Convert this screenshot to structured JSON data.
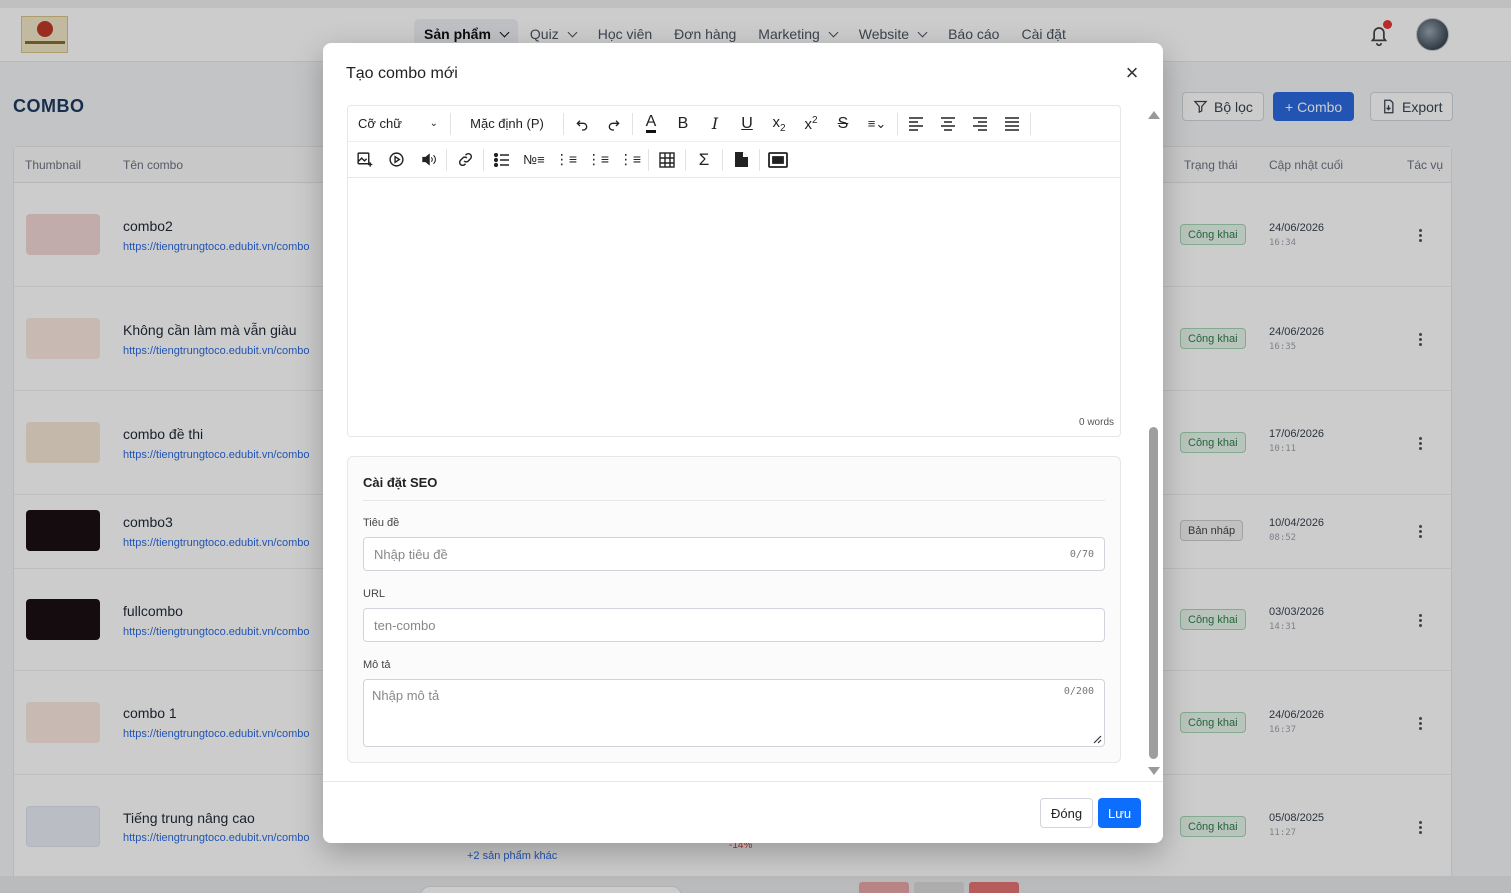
{
  "nav": {
    "items": [
      {
        "label": "Sản phẩm",
        "dropdown": true,
        "active": true
      },
      {
        "label": "Quiz",
        "dropdown": true
      },
      {
        "label": "Học viên",
        "dropdown": false
      },
      {
        "label": "Đơn hàng",
        "dropdown": false
      },
      {
        "label": "Marketing",
        "dropdown": true
      },
      {
        "label": "Website",
        "dropdown": true
      },
      {
        "label": "Báo cáo",
        "dropdown": false
      },
      {
        "label": "Cài đặt",
        "dropdown": false
      }
    ]
  },
  "page": {
    "title": "COMBO",
    "filter_label": "Bộ lọc",
    "add_label": "+ Combo",
    "export_label": "Export"
  },
  "table": {
    "columns": {
      "thumbnail": "Thumbnail",
      "name": "Tên combo",
      "status": "Trạng thái",
      "updated": "Cập nhật cuối",
      "actions": "Tác vụ"
    },
    "rows": [
      {
        "name": "combo2",
        "url": "https://tiengtrungtoco.edubit.vn/combo",
        "status": "Công khai",
        "date": "24/06/2026",
        "time": "16:34"
      },
      {
        "name": "Không cần làm mà vẫn giàu",
        "url": "https://tiengtrungtoco.edubit.vn/combo",
        "status": "Công khai",
        "date": "24/06/2026",
        "time": "16:35"
      },
      {
        "name": "combo đề thi",
        "url": "https://tiengtrungtoco.edubit.vn/combo",
        "status": "Công khai",
        "date": "17/06/2026",
        "time": "10:11"
      },
      {
        "name": "combo3",
        "url": "https://tiengtrungtoco.edubit.vn/combo",
        "status": "Bản nháp",
        "date": "10/04/2026",
        "time": "08:52"
      },
      {
        "name": "fullcombo",
        "url": "https://tiengtrungtoco.edubit.vn/combo",
        "status": "Công khai",
        "date": "03/03/2026",
        "time": "14:31"
      },
      {
        "name": "combo 1",
        "url": "https://tiengtrungtoco.edubit.vn/combo",
        "status": "Công khai",
        "date": "24/06/2026",
        "time": "16:37"
      },
      {
        "name": "Tiếng trung nâng cao",
        "url": "https://tiengtrungtoco.edubit.vn/combo",
        "status": "Công khai",
        "date": "05/08/2025",
        "time": "11:27"
      }
    ],
    "extra_products": "+2 sản phẩm khác",
    "discount": "-14%"
  },
  "modal": {
    "title": "Tạo combo mới",
    "close_symbol": "×",
    "editor": {
      "font_size_label": "Cỡ chữ",
      "paragraph_label": "Mặc định (P)",
      "word_count": "0 words"
    },
    "seo": {
      "section_title": "Cài đặt SEO",
      "title_label": "Tiêu đề",
      "title_placeholder": "Nhập tiêu đề",
      "title_counter": "0/70",
      "url_label": "URL",
      "url_placeholder": "ten-combo",
      "desc_label": "Mô tả",
      "desc_placeholder": "Nhập mô tả",
      "desc_counter": "0/200"
    },
    "footer": {
      "close_label": "Đóng",
      "save_label": "Lưu"
    }
  },
  "colors": {
    "primary": "#2b6be0",
    "save": "#0d6efd",
    "published_bg": "#e8f6ec",
    "published_text": "#2e7d4a",
    "notification": "#e53935"
  }
}
